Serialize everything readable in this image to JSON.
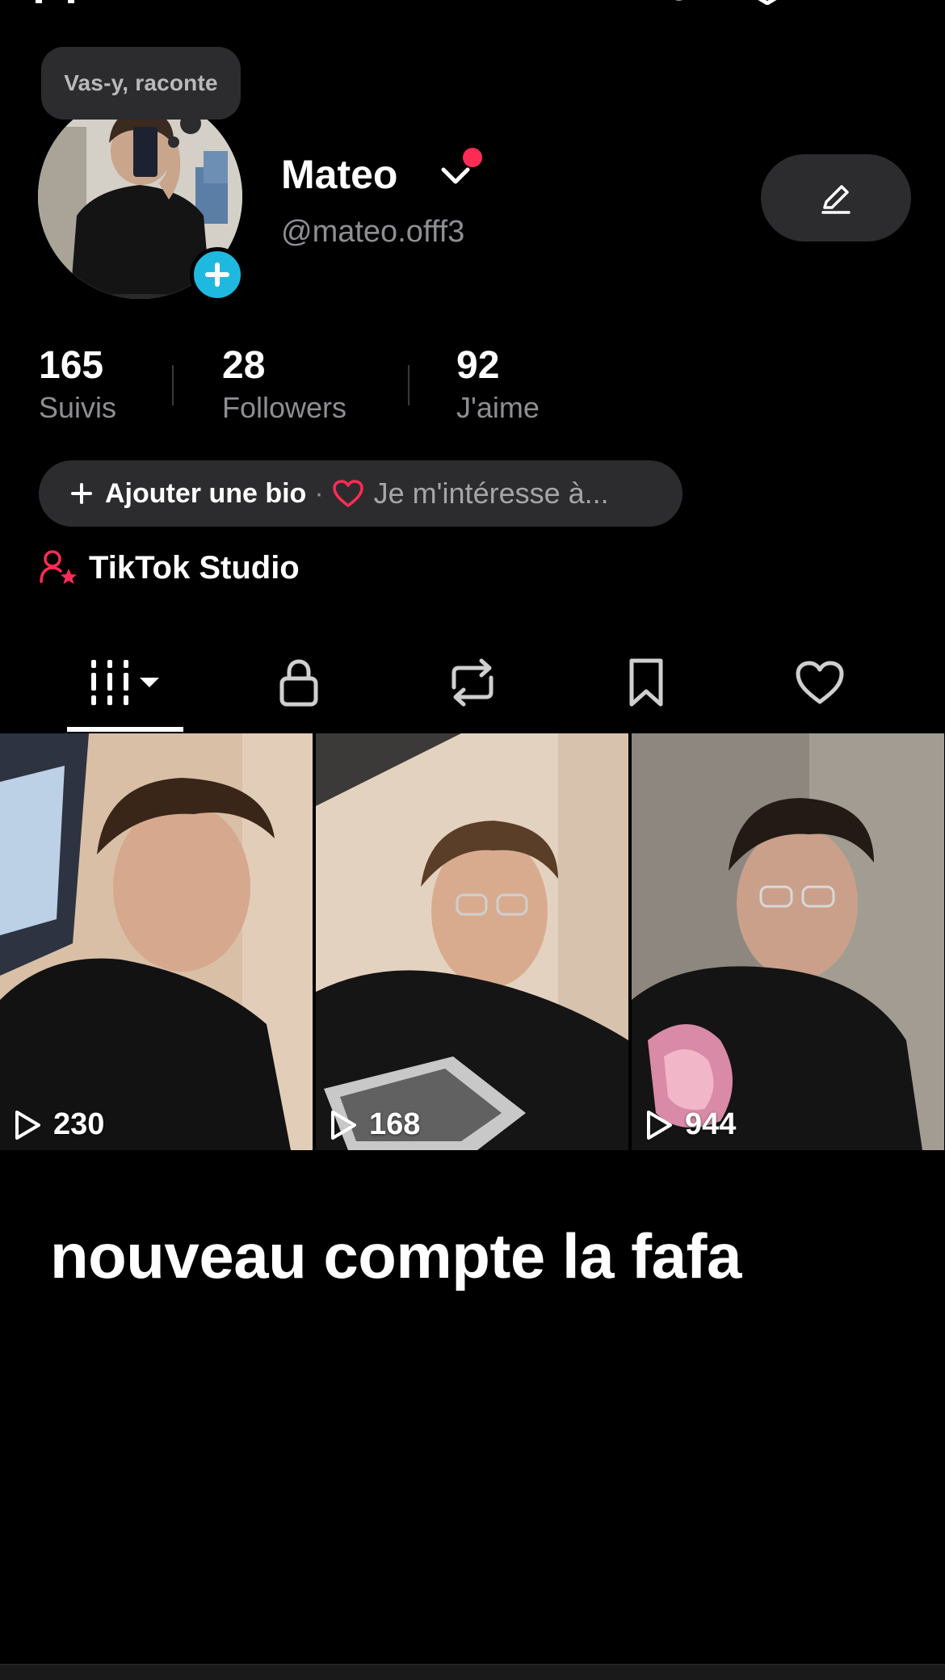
{
  "profile": {
    "bubble_text": "Vas-y, raconte",
    "name": "Mateo",
    "handle": "@mateo.offf3"
  },
  "stats": [
    {
      "value": "165",
      "label": "Suivis"
    },
    {
      "value": "28",
      "label": "Followers"
    },
    {
      "value": "92",
      "label": "J'aime"
    }
  ],
  "bio": {
    "add_label": "Ajouter une bio",
    "separator": "·",
    "interest_label": "Je m'intéresse à..."
  },
  "studio": {
    "label": "TikTok Studio"
  },
  "tabs": [
    {
      "icon": "grid-icon",
      "active": true
    },
    {
      "icon": "lock-icon",
      "active": false
    },
    {
      "icon": "repost-icon",
      "active": false
    },
    {
      "icon": "bookmark-icon",
      "active": false
    },
    {
      "icon": "heart-icon",
      "active": false
    }
  ],
  "videos": [
    {
      "views": "230"
    },
    {
      "views": "168"
    },
    {
      "views": "944"
    }
  ],
  "caption": "nouveau compte la fafa",
  "colors": {
    "background": "#000000",
    "pill": "#2c2c2e",
    "accent_red": "#fe2c55",
    "accent_blue": "#1fb9e0",
    "muted_text": "#8e8e93"
  }
}
